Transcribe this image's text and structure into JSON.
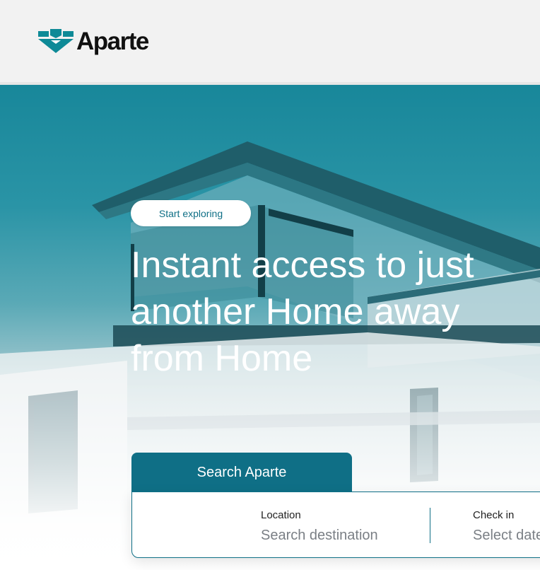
{
  "header": {
    "brand": "Aparte"
  },
  "hero": {
    "pill_label": "Start exploring",
    "headline": "Instant access to just another Home away from Home"
  },
  "search": {
    "tab_label": "Search Aparte",
    "location": {
      "label": "Location",
      "placeholder": "Search destination"
    },
    "checkin": {
      "label": "Check in",
      "placeholder": "Select date"
    }
  },
  "colors": {
    "brand_teal": "#0f6f86",
    "logo_teal": "#0e8a97",
    "header_bg": "#f2f2f2"
  },
  "icons": {
    "logo": "aparte-logo-mark"
  }
}
